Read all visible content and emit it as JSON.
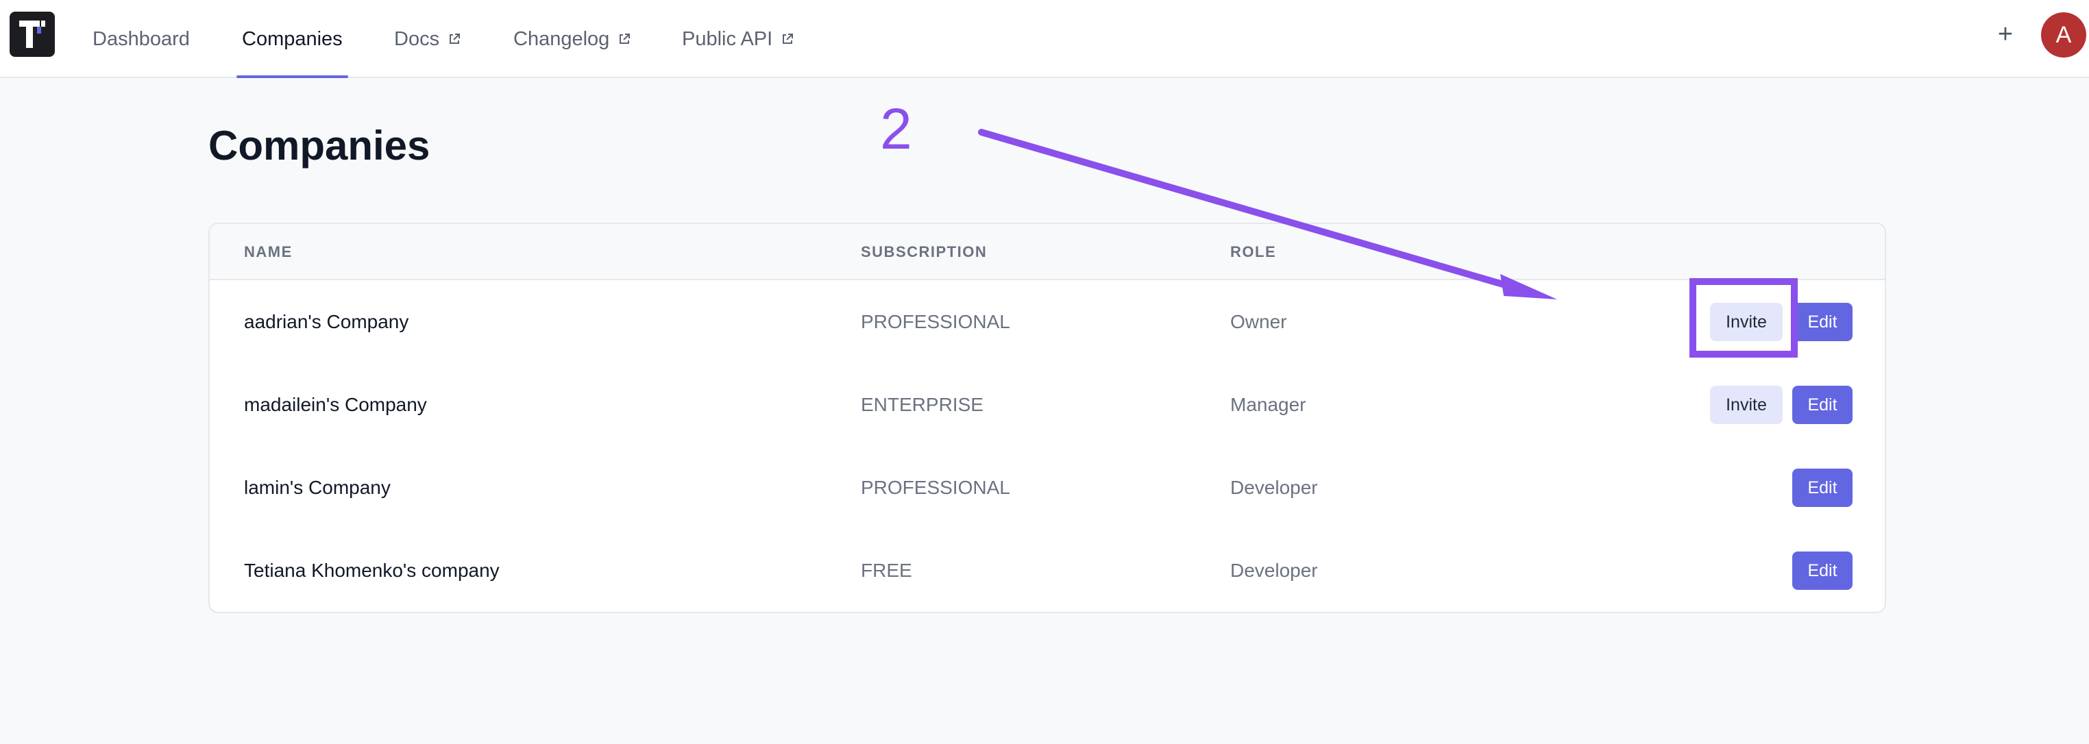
{
  "nav": {
    "logo_label": "T",
    "items": [
      {
        "label": "Dashboard",
        "external": false,
        "active": false
      },
      {
        "label": "Companies",
        "external": false,
        "active": true
      },
      {
        "label": "Docs",
        "external": true,
        "active": false
      },
      {
        "label": "Changelog",
        "external": true,
        "active": false
      },
      {
        "label": "Public API",
        "external": true,
        "active": false
      }
    ],
    "plus_label": "+",
    "avatar_initial": "A"
  },
  "page": {
    "title": "Companies"
  },
  "table": {
    "headers": [
      "NAME",
      "SUBSCRIPTION",
      "ROLE"
    ],
    "rows": [
      {
        "name": "aadrian's Company",
        "subscription": "PROFESSIONAL",
        "role": "Owner",
        "invite_label": "Invite",
        "edit_label": "Edit"
      },
      {
        "name": "madailein's Company",
        "subscription": "ENTERPRISE",
        "role": "Manager",
        "invite_label": "Invite",
        "edit_label": "Edit"
      },
      {
        "name": "lamin's Company",
        "subscription": "PROFESSIONAL",
        "role": "Developer",
        "edit_label": "Edit"
      },
      {
        "name": "Tetiana Khomenko's company",
        "subscription": "FREE",
        "role": "Developer",
        "edit_label": "Edit"
      }
    ]
  },
  "annotation": {
    "step_number": "2",
    "color": "#8a50ec"
  },
  "colors": {
    "accent": "#6366e1",
    "invite_bg": "#e4e7fb",
    "avatar_bg": "#b53232"
  }
}
